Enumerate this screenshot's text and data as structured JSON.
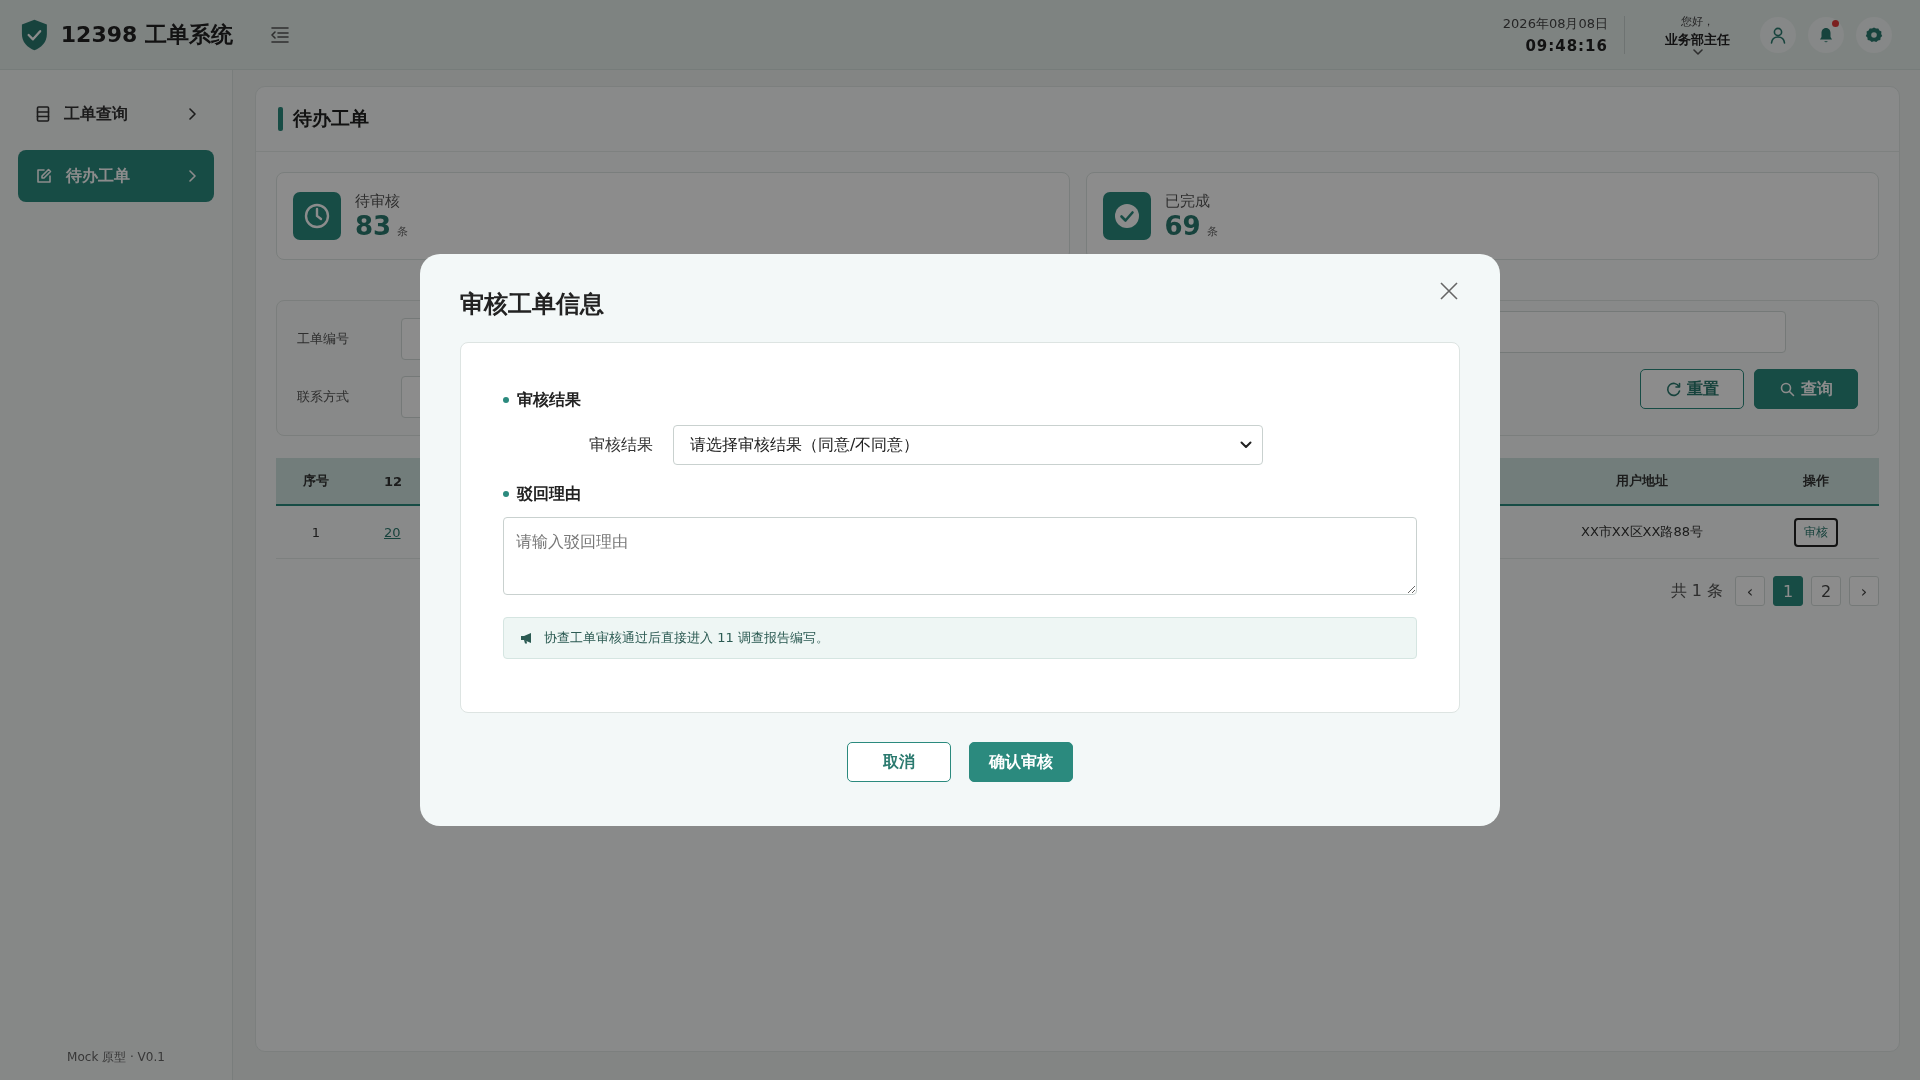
{
  "header": {
    "logo": "12398 工单系统",
    "date": "2026年08月08日",
    "time": "09:48:16",
    "greeting": "您好，",
    "user": "业务部主任",
    "notification_dot": true
  },
  "sidebar": {
    "items": [
      {
        "label": "工单查询",
        "selected": false,
        "kind": "list"
      },
      {
        "label": "待办工单",
        "selected": true,
        "kind": "edit"
      }
    ],
    "footer": "Mock 原型 · V0.1"
  },
  "page": {
    "title": "待办工单"
  },
  "stats": [
    {
      "label": "待审核",
      "value": "83",
      "unit": "条",
      "kind": "clock"
    },
    {
      "label": "已完成",
      "value": "69",
      "unit": "条",
      "kind": "check"
    }
  ],
  "filters": [
    {
      "label": "工单编号"
    },
    {
      "label": "联系方式"
    }
  ],
  "filter_buttons": [
    {
      "label": "重置",
      "kind": "reset"
    },
    {
      "label": "查询",
      "kind": "search"
    }
  ],
  "table": {
    "columns": [
      "序号",
      "12",
      "用户地址",
      "操作"
    ],
    "rows": [
      {
        "cells": [
          "1",
          "20",
          "XX市XX区XX路88号"
        ],
        "action": "审核"
      }
    ]
  },
  "pagination": {
    "total": "共 1 条",
    "prev": "‹",
    "next": "›",
    "pages": [
      {
        "label": "1",
        "selected": true
      },
      {
        "label": "2",
        "selected": false
      }
    ]
  },
  "dialog": {
    "title": "审核工单信息",
    "sections": [
      {
        "heading": "审核结果",
        "kind": "select",
        "field_label": "审核结果",
        "value": "请选择审核结果（同意/不同意）"
      },
      {
        "heading": "驳回理由",
        "kind": "textarea",
        "placeholder": "请输入驳回理由"
      }
    ],
    "notice": "协查工单审核通过后直接进入 11 调查报告编写。",
    "buttons": [
      {
        "label": "取消",
        "kind": "secondary"
      },
      {
        "label": "确认审核",
        "kind": "primary"
      }
    ]
  }
}
